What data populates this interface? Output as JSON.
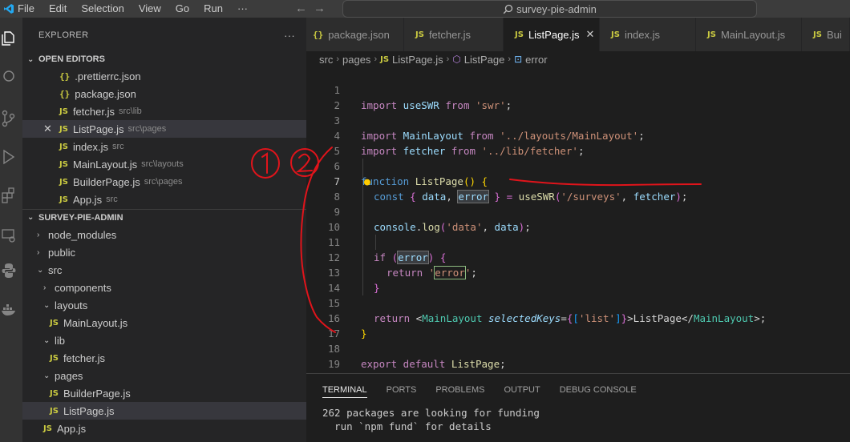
{
  "menu": [
    "File",
    "Edit",
    "Selection",
    "View",
    "Go",
    "Run",
    "···"
  ],
  "search": {
    "text": "survey-pie-admin"
  },
  "explorer": {
    "title": "EXPLORER",
    "more": "···",
    "open_editors_label": "OPEN EDITORS",
    "open_editors": [
      {
        "badge": "{}",
        "name": ".prettierrc.json",
        "hint": ""
      },
      {
        "badge": "{}",
        "name": "package.json",
        "hint": ""
      },
      {
        "badge": "JS",
        "name": "fetcher.js",
        "hint": "src\\lib"
      },
      {
        "badge": "JS",
        "name": "ListPage.js",
        "hint": "src\\pages"
      },
      {
        "badge": "JS",
        "name": "index.js",
        "hint": "src"
      },
      {
        "badge": "JS",
        "name": "MainLayout.js",
        "hint": "src\\layouts"
      },
      {
        "badge": "JS",
        "name": "BuilderPage.js",
        "hint": "src\\pages"
      },
      {
        "badge": "JS",
        "name": "App.js",
        "hint": "src"
      }
    ],
    "project_label": "SURVEY-PIE-ADMIN",
    "tree": [
      {
        "name": "node_modules"
      },
      {
        "name": "public"
      },
      {
        "name": "src"
      },
      {
        "name": "components"
      },
      {
        "name": "layouts"
      },
      {
        "name": "MainLayout.js"
      },
      {
        "name": "lib"
      },
      {
        "name": "fetcher.js"
      },
      {
        "name": "pages"
      },
      {
        "name": "BuilderPage.js"
      },
      {
        "name": "ListPage.js"
      },
      {
        "name": "App.js"
      }
    ]
  },
  "tabs": [
    {
      "badge": "{}",
      "label": "package.json"
    },
    {
      "badge": "JS",
      "label": "fetcher.js"
    },
    {
      "badge": "JS",
      "label": "ListPage.js"
    },
    {
      "badge": "JS",
      "label": "index.js"
    },
    {
      "badge": "JS",
      "label": "MainLayout.js"
    },
    {
      "badge": "JS",
      "label": "Bui"
    }
  ],
  "breadcrumb": [
    "src",
    "pages",
    "ListPage.js",
    "ListPage",
    "error"
  ],
  "editor": {
    "line_numbers": [
      "1",
      "2",
      "3",
      "4",
      "5",
      "6",
      "7",
      "8",
      "9",
      "10",
      "11",
      "12",
      "13",
      "14",
      "15",
      "16",
      "17",
      "18",
      "19"
    ],
    "code": {
      "l1_import": "import",
      "l1_name": " useSWR ",
      "l1_from": "from",
      "l1_str": " 'swr'",
      "l1_end": ";",
      "l3_import": "import",
      "l3_name": " MainLayout ",
      "l3_from": "from",
      "l3_str": " '../layouts/MainLayout'",
      "l3_end": ";",
      "l4_import": "import",
      "l4_name": " fetcher ",
      "l4_from": "from",
      "l4_str": " '../lib/fetcher'",
      "l4_end": ";",
      "l6_kw": "function",
      "l6_name": " ListPage",
      "l6_paren": "()",
      "l6_brace": " {",
      "l7_const": "const",
      "l7_open": " { ",
      "l7_data": "data",
      "l7_comma": ", ",
      "l7_error": "error",
      "l7_close": " } = ",
      "l7_fn": "useSWR",
      "l7_p1": "(",
      "l7_str": "'/surveys'",
      "l7_comma2": ", ",
      "l7_fetcher": "fetcher",
      "l7_p2": ")",
      "l7_end": ";",
      "l9_console": "console",
      "l9_dot": ".",
      "l9_log": "log",
      "l9_p1": "(",
      "l9_str": "'data'",
      "l9_comma": ", ",
      "l9_data": "data",
      "l9_p2": ")",
      "l9_end": ";",
      "l11_if": "if",
      "l11_p1": " (",
      "l11_error": "error",
      "l11_p2": ")",
      "l11_brace": " {",
      "l12_return": "return",
      "l12_q1": " '",
      "l12_error": "error",
      "l12_q2": "'",
      "l12_end": ";",
      "l13_brace": "}",
      "l15_return": "return",
      "l15_lt": " <",
      "l15_tag": "MainLayout",
      "l15_attr": " selectedKeys",
      "l15_eq": "=",
      "l15_b1": "{",
      "l15_b2": "[",
      "l15_str": "'list'",
      "l15_b3": "]",
      "l15_b4": "}",
      "l15_gt": ">",
      "l15_text": "ListPage",
      "l15_close": "</",
      "l15_tag2": "MainLayout",
      "l15_gt2": ">",
      "l15_end": ";",
      "l16_brace": "}",
      "l18_export": "export",
      "l18_default": " default",
      "l18_name": " ListPage",
      "l18_end": ";"
    }
  },
  "panel": {
    "tabs": [
      "TERMINAL",
      "PORTS",
      "PROBLEMS",
      "OUTPUT",
      "DEBUG CONSOLE"
    ],
    "lines": [
      "262 packages are looking for funding",
      "  run `npm fund` for details"
    ]
  },
  "colors": {
    "annotation": "#e0141b",
    "js_badge": "#cbcb41",
    "accent": "#007acc"
  }
}
